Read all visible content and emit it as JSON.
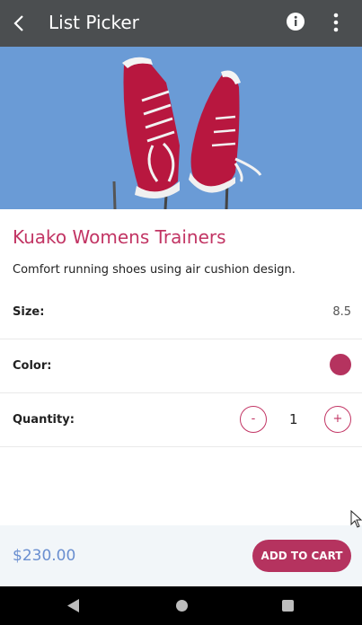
{
  "appbar": {
    "title": "List Picker",
    "icons": {
      "back": "back-arrow-icon",
      "info": "info-icon",
      "menu": "more-vert-icon"
    }
  },
  "product": {
    "image": "red-sneakers-photo",
    "title": "Kuako Womens Trainers",
    "description": "Comfort running shoes using air cushion design.",
    "title_color": "#c23564"
  },
  "options": {
    "size": {
      "label": "Size:",
      "value": "8.5"
    },
    "color": {
      "label": "Color:",
      "swatch": "#b5335f"
    },
    "quantity": {
      "label": "Quantity:",
      "value": "1",
      "decrement": "-",
      "increment": "+"
    }
  },
  "footer": {
    "price": "$230.00",
    "cart_label": "ADD TO CART",
    "accent": "#b5335f"
  },
  "system_nav": {
    "back": "nav-back-icon",
    "home": "nav-home-icon",
    "recent": "nav-recent-icon"
  }
}
